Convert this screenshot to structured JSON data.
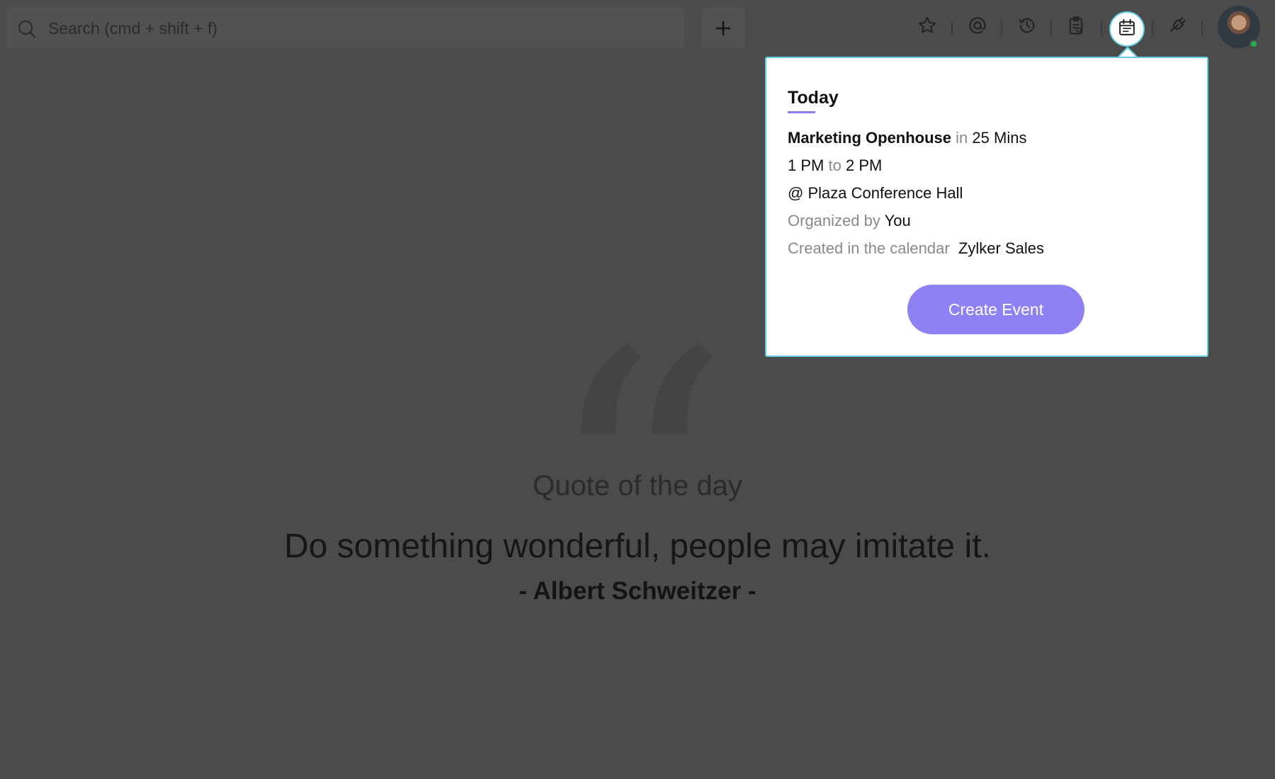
{
  "topbar": {
    "search_placeholder": "Search (cmd + shift + f)",
    "add_label": "+",
    "icons": [
      "star-icon",
      "mention-icon",
      "history-icon",
      "clipboard-icon",
      "calendar-icon",
      "plug-icon"
    ]
  },
  "calendar_popup": {
    "heading": "Today",
    "event_title": "Marketing Openhouse",
    "in_word": "in",
    "countdown": "25 Mins",
    "start_time": "1 PM",
    "to_word": "to",
    "end_time": "2 PM",
    "location": "@ Plaza Conference Hall",
    "organized_label": "Organized by",
    "organizer": "You",
    "calendar_label": "Created in the calendar",
    "calendar_name": "Zylker Sales",
    "button_label": "Create Event"
  },
  "quote": {
    "label": "Quote of the day",
    "text": "Do something wonderful, people may imitate it.",
    "author": "- Albert Schweitzer -"
  },
  "colors": {
    "accent": "#8f80f4",
    "popup_border": "#5fcfe0",
    "overlay_background": "#4b4b4b"
  }
}
